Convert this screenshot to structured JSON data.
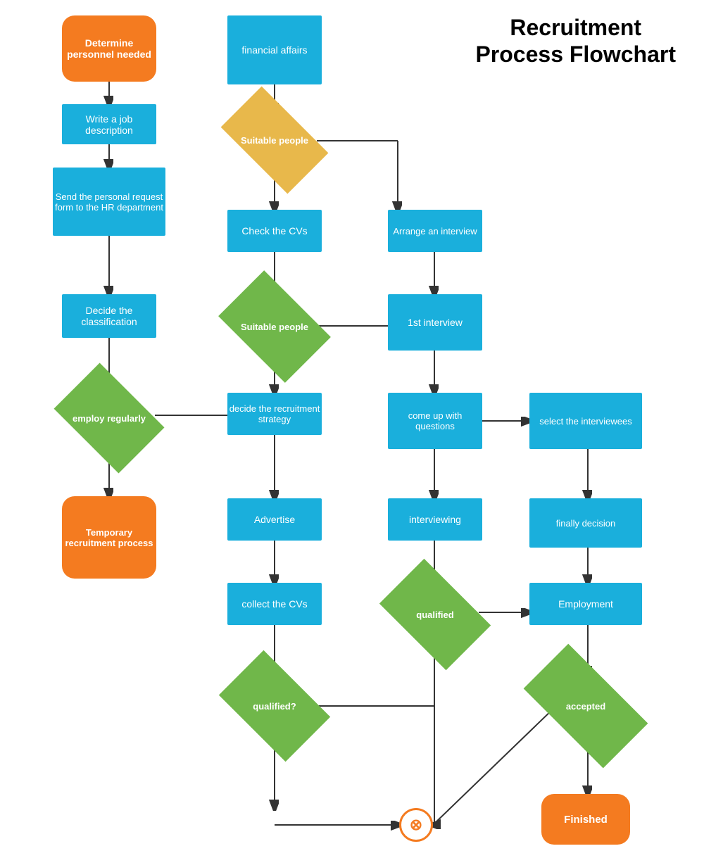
{
  "title": "Recruitment\nProcess Flowchart",
  "nodes": {
    "determine": "Determine personnel needed",
    "write_job": "Write a job description",
    "send_personal": "Send the personal request form to the HR department",
    "decide_class": "Decide the classification",
    "employ_regularly": "employ regularly",
    "temporary": "Temporary recruitment process",
    "financial": "financial affairs",
    "suitable1": "Suitable people",
    "check_cvs": "Check the CVs",
    "suitable2": "Suitable people",
    "decide_recruitment": "decide the recruitment strategy",
    "advertise": "Advertise",
    "collect_cvs": "collect the CVs",
    "qualified1": "qualified?",
    "arrange": "Arrange an interview",
    "first_interview": "1st interview",
    "come_up": "come up with questions",
    "interviewing": "interviewing",
    "qualified2": "qualified",
    "select": "select the interviewees",
    "finally": "finally decision",
    "employment": "Employment",
    "accepted": "accepted",
    "finished": "Finished",
    "cancel": "⊗"
  }
}
